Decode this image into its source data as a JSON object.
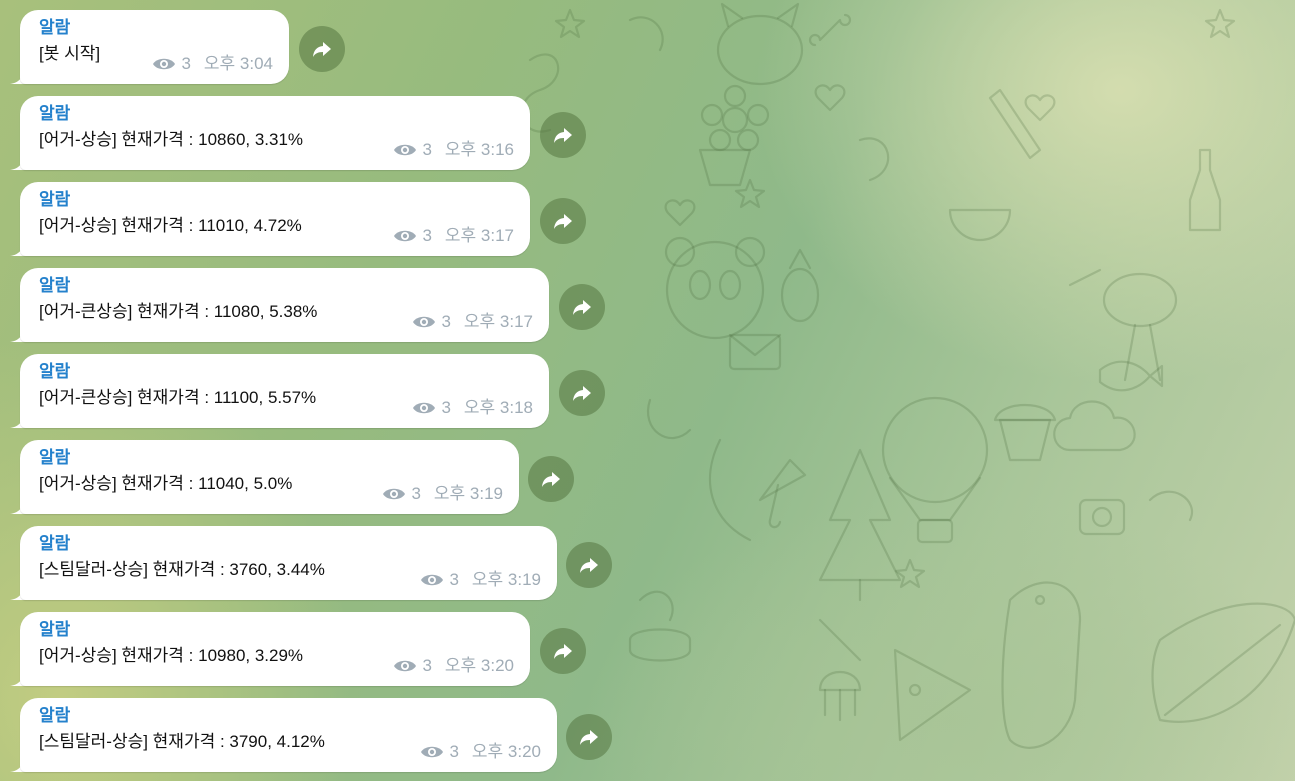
{
  "chat": {
    "messages": [
      {
        "sender": "알람",
        "text": "[봇 시작]",
        "views": "3",
        "time": "오후 3:04"
      },
      {
        "sender": "알람",
        "text": "[어거-상승] 현재가격 : 10860,  3.31%",
        "views": "3",
        "time": "오후 3:16"
      },
      {
        "sender": "알람",
        "text": "[어거-상승] 현재가격 : 11010,  4.72%",
        "views": "3",
        "time": "오후 3:17"
      },
      {
        "sender": "알람",
        "text": "[어거-큰상승] 현재가격 : 11080,  5.38%",
        "views": "3",
        "time": "오후 3:17"
      },
      {
        "sender": "알람",
        "text": "[어거-큰상승] 현재가격 : 11100,  5.57%",
        "views": "3",
        "time": "오후 3:18"
      },
      {
        "sender": "알람",
        "text": "[어거-상승] 현재가격 : 11040,  5.0%",
        "views": "3",
        "time": "오후 3:19"
      },
      {
        "sender": "알람",
        "text": "[스팀달러-상승] 현재가격 : 3760,  3.44%",
        "views": "3",
        "time": "오후 3:19"
      },
      {
        "sender": "알람",
        "text": "[어거-상승] 현재가격 : 10980,  3.29%",
        "views": "3",
        "time": "오후 3:20"
      },
      {
        "sender": "알람",
        "text": "[스팀달러-상승] 현재가격 : 3790,  4.12%",
        "views": "3",
        "time": "오후 3:20"
      }
    ]
  },
  "icons": {
    "views": "eye-icon",
    "forward": "share-icon"
  },
  "colors": {
    "sender_name": "#2481cc",
    "meta_text": "#a0acb6",
    "bubble": "#ffffff",
    "share_button": "#567642"
  }
}
